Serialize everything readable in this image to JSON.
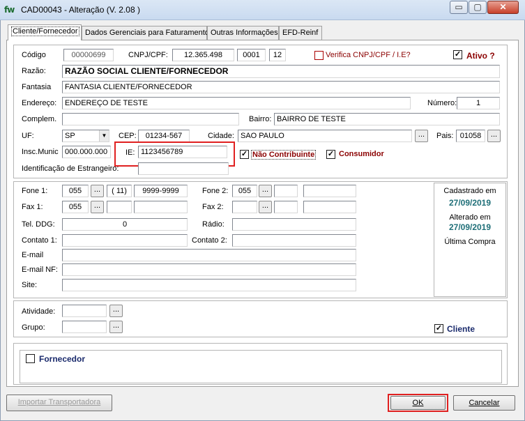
{
  "window": {
    "icon_text": "fw",
    "title": "CAD00043 - Alteração  (V.  2.08 )",
    "min": "▭",
    "max": "▢",
    "close": "✕"
  },
  "tabs": [
    {
      "label": "Cliente/Fornecedor"
    },
    {
      "label": "Dados Gerenciais para Faturamento"
    },
    {
      "label": "Outras Informações"
    },
    {
      "label": "EFD-Reinf"
    }
  ],
  "form": {
    "codigo_label": "Código",
    "codigo_value": "00000699",
    "cnpj_label": "CNPJ/CPF:",
    "cnpj_value": "12.365.498",
    "cnpj_branch": "0001",
    "cnpj_dv": "12",
    "verifica_label": "Verifica CNPJ/CPF / I.E?",
    "ativo_label": "Ativo ?",
    "razao_label": "Razão:",
    "razao_value": "RAZÃO SOCIAL CLIENTE/FORNECEDOR",
    "fantasia_label": "Fantasia",
    "fantasia_value": "FANTASIA CLIENTE/FORNECEDOR",
    "endereco_label": "Endereço:",
    "endereco_value": "ENDEREÇO DE TESTE",
    "numero_label": "Número:",
    "numero_value": "1",
    "complem_label": "Complem.",
    "complem_value": "",
    "bairro_label": "Bairro:",
    "bairro_value": "BAIRRO DE TESTE",
    "uf_label": "UF:",
    "uf_value": "SP",
    "cep_label": "CEP:",
    "cep_value": "01234-567",
    "cidade_label": "Cidade:",
    "cidade_value": "SAO PAULO",
    "pais_label": "Pais:",
    "pais_value": "01058",
    "insc_label": "Insc.Munic",
    "insc_value": "000.000.000",
    "ie_label": "IE:",
    "ie_value": "1123456789",
    "nao_contribuinte_label": "Não Contribuinte",
    "consumidor_label": "Consumidor",
    "estrangeiro_label": "Identificação de Estrangeiro:",
    "ellipsis": "..."
  },
  "contact": {
    "fone1_label": "Fone 1:",
    "fone1_ddi": "055",
    "fone1_ddd": "( 11)",
    "fone1_num": "9999-9999",
    "fone2_label": "Fone 2:",
    "fone2_ddi": "055",
    "fax1_label": "Fax 1:",
    "fax1_ddi": "055",
    "fax2_label": "Fax 2:",
    "tel_ddg_label": "Tel. DDG:",
    "tel_ddg_value": "0",
    "radio_label": "Rádio:",
    "contato1_label": "Contato 1:",
    "contato2_label": "Contato 2:",
    "email_label": "E-mail",
    "emailnf_label": "E-mail NF:",
    "site_label": "Site:"
  },
  "info": {
    "cadastrado_label": "Cadastrado em",
    "cadastrado_value": "27/09/2019",
    "alterado_label": "Alterado em",
    "alterado_value": "27/09/2019",
    "ultima_label": "Última Compra"
  },
  "activity": {
    "atividade_label": "Atividade:",
    "grupo_label": "Grupo:",
    "cliente_label": "Cliente"
  },
  "fornecedor": {
    "label": "Fornecedor"
  },
  "buttons": {
    "importar": "Importar Transportadora",
    "ok": "OK",
    "cancelar": "Cancelar"
  },
  "colors": {
    "accent_red": "#8b0000",
    "teal": "#1f6f78",
    "highlight": "#e02020"
  }
}
